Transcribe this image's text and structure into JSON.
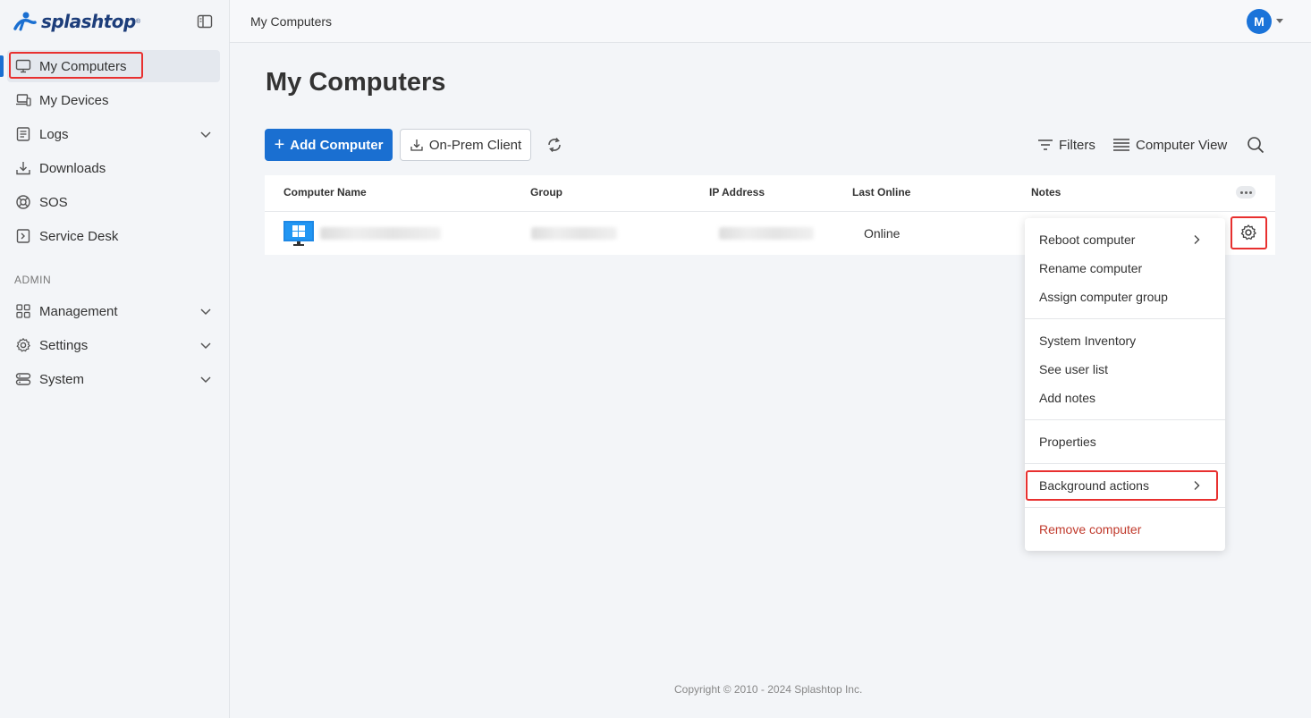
{
  "app": {
    "brand": "splashtop",
    "trademark": "®",
    "accent": "#1a6fd1",
    "danger": "#c0392b"
  },
  "sidebar": {
    "items": [
      {
        "label": "My Computers",
        "icon": "monitor-icon"
      },
      {
        "label": "My Devices",
        "icon": "devices-icon"
      },
      {
        "label": "Logs",
        "icon": "logs-icon"
      },
      {
        "label": "Downloads",
        "icon": "download-icon"
      },
      {
        "label": "SOS",
        "icon": "sos-icon"
      },
      {
        "label": "Service Desk",
        "icon": "service-desk-icon"
      }
    ],
    "admin_label": "ADMIN",
    "admin_items": [
      {
        "label": "Management",
        "icon": "grid-icon"
      },
      {
        "label": "Settings",
        "icon": "gear-icon"
      },
      {
        "label": "System",
        "icon": "server-icon"
      }
    ]
  },
  "header": {
    "breadcrumb": "My Computers",
    "avatar_initial": "M"
  },
  "main": {
    "title": "My Computers",
    "add_button": "Add Computer",
    "onprem_button": "On-Prem Client",
    "filters_label": "Filters",
    "view_label": "Computer View"
  },
  "table": {
    "columns": [
      "Computer Name",
      "Group",
      "IP Address",
      "Last Online",
      "Notes"
    ],
    "rows": [
      {
        "last_online": "Online"
      }
    ]
  },
  "menu": {
    "group1": [
      "Reboot computer",
      "Rename computer",
      "Assign computer group"
    ],
    "group2": [
      "System Inventory",
      "See user list",
      "Add notes"
    ],
    "group3": [
      "Properties"
    ],
    "group4": [
      "Background actions"
    ],
    "group5": [
      "Remove computer"
    ]
  },
  "footer": {
    "copyright": "Copyright © 2010 - 2024 Splashtop Inc."
  }
}
